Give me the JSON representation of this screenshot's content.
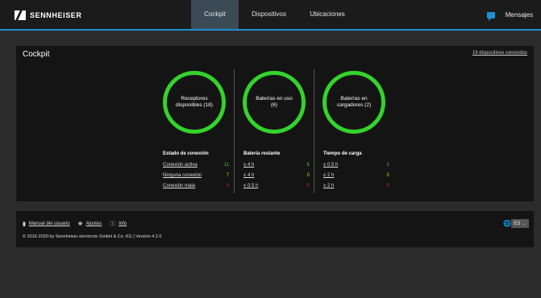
{
  "brand": "SENNHEISER",
  "nav": {
    "tabs": [
      {
        "label": "Cockpit",
        "active": true
      },
      {
        "label": "Dispositivos",
        "active": false
      },
      {
        "label": "Ubicaciones",
        "active": false
      }
    ],
    "messages_label": "Mensajes"
  },
  "cockpit": {
    "title": "Cockpit",
    "known_devices_link": "19 dispositivos conocidos",
    "rings": [
      {
        "label": "Receptores disponibles (18)"
      },
      {
        "label": "Baterías en uso (6)"
      },
      {
        "label": "Baterías en cargadores (2)"
      }
    ],
    "columns": [
      {
        "title": "Estado de conexión",
        "rows": [
          {
            "label": "Conexión activa",
            "value": "11",
            "color": "#49c43b"
          },
          {
            "label": "Ninguna conexión",
            "value": "7",
            "color": "#f0c800"
          },
          {
            "label": "Conexión mala",
            "value": "0",
            "color": "#e02525"
          }
        ]
      },
      {
        "title": "Batería restante",
        "rows": [
          {
            "label": "≥ 4 h",
            "value": "6",
            "color": "#49c43b"
          },
          {
            "label": "≤ 4 h",
            "value": "0",
            "color": "#f0c800"
          },
          {
            "label": "≤ 0.5 h",
            "value": "0",
            "color": "#e02525"
          }
        ]
      },
      {
        "title": "Tiempo de carga",
        "rows": [
          {
            "label": "≤ 0.5 h",
            "value": "2",
            "color": "#49c43b"
          },
          {
            "label": "≤ 2 h",
            "value": "0",
            "color": "#f0c800"
          },
          {
            "label": "≥ 2 h",
            "value": "0",
            "color": "#e02525"
          }
        ]
      }
    ]
  },
  "footer": {
    "manual_label": "Manual del usuario",
    "settings_label": "Ajustes",
    "info_label": "Info",
    "copyright": "© 2016-2020 by Sennheiser electronic GmbH & Co. KG | Versión 4.2.0",
    "language": "ES"
  },
  "colors": {
    "accent": "#1d8fd6",
    "ring_green": "#33d32b",
    "status_green": "#49c43b",
    "status_yellow": "#f0c800",
    "status_red": "#e02525"
  },
  "icons": [
    "sennheiser-logo-icon",
    "message-icon",
    "manual-icon",
    "gear-icon",
    "info-icon",
    "globe-icon",
    "chevron-down-icon"
  ]
}
